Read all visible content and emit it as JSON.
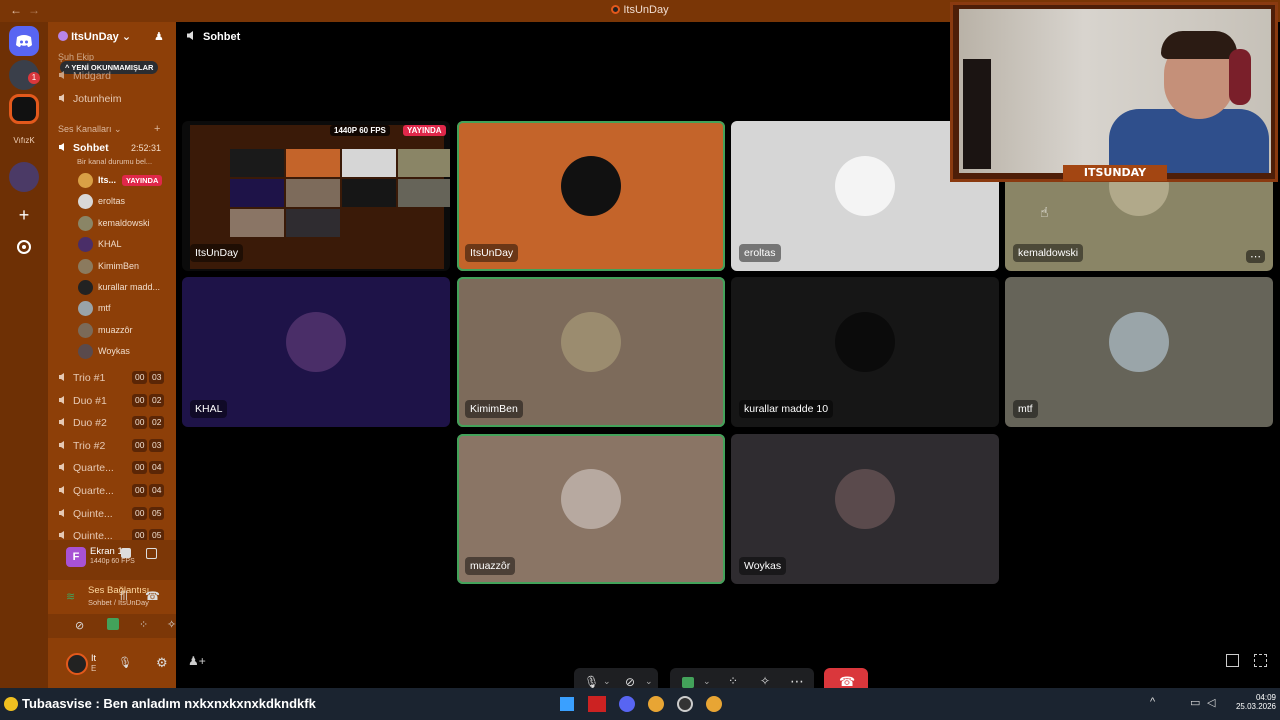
{
  "window": {
    "title": "ItsUnDay",
    "back": "←",
    "forward": "→"
  },
  "rail": {
    "label": "VıfızK",
    "notif": "1"
  },
  "server": {
    "name": "ItsUnDay",
    "chevron": "⌄"
  },
  "sidebar": {
    "unread_banner": "YENİ OKUNMAMIŞLAR",
    "partial_category": "Şuh Ekip",
    "text_channels": [
      {
        "label": "Midgard"
      },
      {
        "label": "Jotunheim"
      }
    ],
    "voice_category": "Ses Kanalları",
    "active_channel": {
      "label": "Sohbet",
      "timer": "2:52:31",
      "status": "Bir kanal durumu bel..."
    },
    "members": [
      {
        "name": "Its...",
        "badge": "YAYINDA",
        "color": "#d9a045"
      },
      {
        "name": "eroltas",
        "color": "#d8d8d8"
      },
      {
        "name": "kemaldowski",
        "color": "#8a8566"
      },
      {
        "name": "KHAL",
        "color": "#4a2e68"
      },
      {
        "name": "KimimBen",
        "color": "#8b7a5e"
      },
      {
        "name": "kurallar madd...",
        "color": "#222"
      },
      {
        "name": "mtf",
        "color": "#99a3a8"
      },
      {
        "name": "muazzôr",
        "color": "#7b6a58"
      },
      {
        "name": "Woykas",
        "color": "#5a4a4c"
      }
    ],
    "channels": [
      {
        "label": "Trio #1",
        "a": "00",
        "b": "03"
      },
      {
        "label": "Duo #1",
        "a": "00",
        "b": "02"
      },
      {
        "label": "Duo #2",
        "a": "00",
        "b": "02"
      },
      {
        "label": "Trio #2",
        "a": "00",
        "b": "03"
      },
      {
        "label": "Quarte...",
        "a": "00",
        "b": "04"
      },
      {
        "label": "Quarte...",
        "a": "00",
        "b": "04"
      },
      {
        "label": "Quinte...",
        "a": "00",
        "b": "05"
      },
      {
        "label": "Quinte...",
        "a": "00",
        "b": "05"
      }
    ]
  },
  "stream_panel": {
    "title": "Ekran 1",
    "quality": "1440p 60 FPS",
    "avatar_letter": "F"
  },
  "voice_panel": {
    "title": "Ses Bağlantısı K",
    "subtitle": "Sohbet / ItsUnDay"
  },
  "user_panel": {
    "name": "It",
    "status": "E"
  },
  "main": {
    "channel": "Sohbet"
  },
  "tiles": [
    {
      "name": "ItsUnDay",
      "color": "#0b0b0b",
      "stream": true,
      "quality": "1440P 60 FPS",
      "badge": "YAYINDA",
      "speaking": false
    },
    {
      "name": "ItsUnDay",
      "color": "#c4642a",
      "avatar": "#111",
      "speaking": true
    },
    {
      "name": "eroltas",
      "color": "#d6d6d6",
      "avatar": "#f4f4f4",
      "speaking": false
    },
    {
      "name": "kemaldowski",
      "color": "#8a8566",
      "avatar": "#b1a98a",
      "speaking": false
    },
    {
      "name": "KHAL",
      "color": "#1e1348",
      "avatar": "#4a2e68",
      "speaking": false
    },
    {
      "name": "KimimBen",
      "color": "#7d6b5b",
      "avatar": "#9b8c6f",
      "speaking": true
    },
    {
      "name": "kurallar madde 10",
      "color": "#161616",
      "avatar": "#0b0b0b",
      "speaking": false
    },
    {
      "name": "mtf",
      "color": "#666459",
      "avatar": "#9aa5a9",
      "speaking": false
    },
    {
      "name": "muazzôr",
      "color": "#8a7565",
      "avatar": "#b7a9a0",
      "speaking": true
    },
    {
      "name": "Woykas",
      "color": "#2f2c30",
      "avatar": "#5a4a4c",
      "speaking": false
    }
  ],
  "webcam": {
    "name": "ITSUNDAY"
  },
  "taskbar": {
    "ticker": "Tubaasvise : Ben anladım nxkxnxkxnxkdkndkfk",
    "time": "04:09",
    "date": "25.03.2026"
  },
  "colors": {
    "accent": "#e3591c",
    "sidebar": "#8d3f08",
    "speaking": "#43a25a",
    "live": "#e0284a",
    "hangup": "#da373c"
  }
}
